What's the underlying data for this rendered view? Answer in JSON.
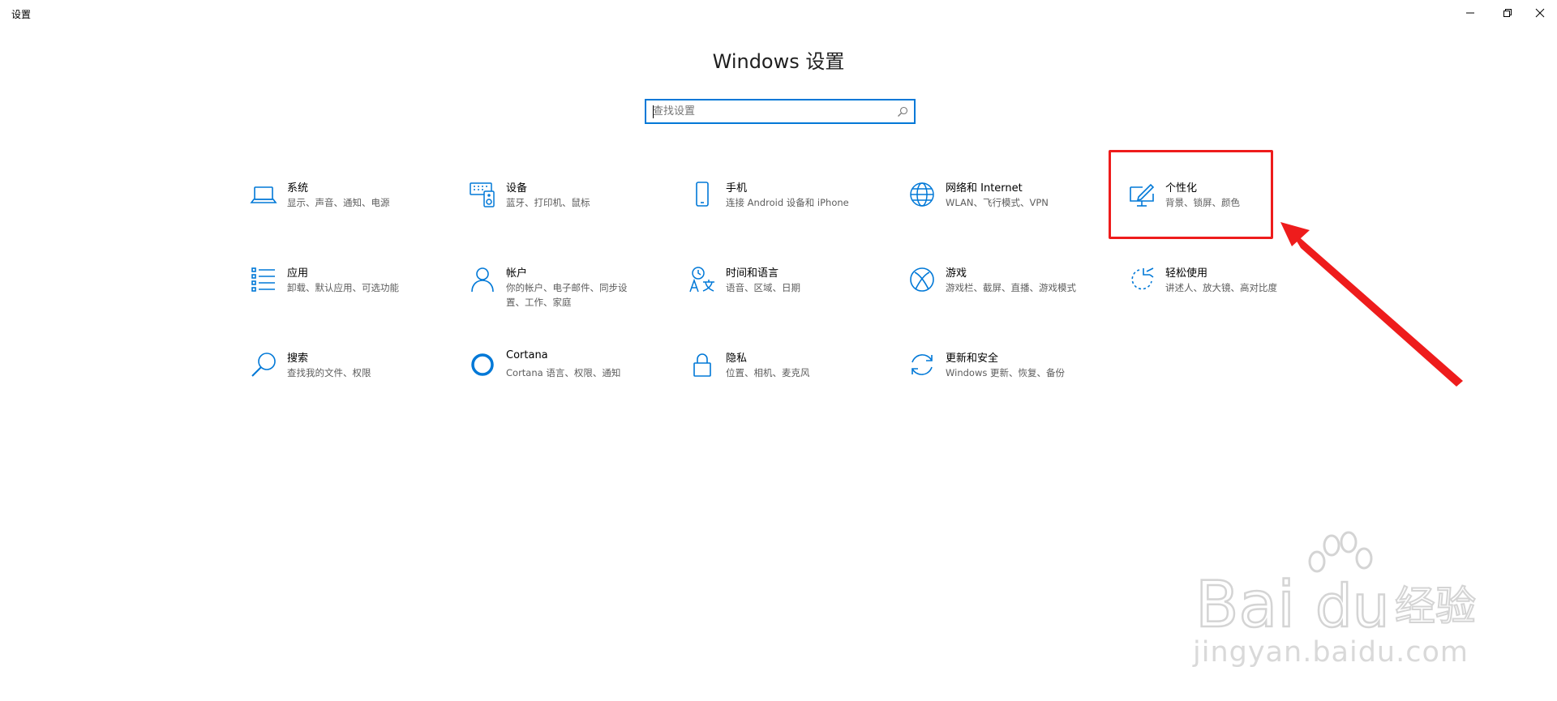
{
  "window": {
    "title": "设置",
    "controls": {
      "minimize": "minimize-icon",
      "restore": "restore-icon",
      "close": "close-icon"
    }
  },
  "page": {
    "title": "Windows 设置"
  },
  "search": {
    "placeholder": "查找设置",
    "icon": "search-icon"
  },
  "accent_color": "#0078d7",
  "tiles": [
    {
      "name": "系统",
      "desc": "显示、声音、通知、电源",
      "icon": "laptop-icon"
    },
    {
      "name": "设备",
      "desc": "蓝牙、打印机、鼠标",
      "icon": "devices-icon"
    },
    {
      "name": "手机",
      "desc": "连接 Android 设备和 iPhone",
      "icon": "phone-icon"
    },
    {
      "name": "网络和 Internet",
      "desc": "WLAN、飞行模式、VPN",
      "icon": "globe-icon"
    },
    {
      "name": "个性化",
      "desc": "背景、锁屏、颜色",
      "icon": "personalization-icon"
    },
    {
      "name": "应用",
      "desc": "卸载、默认应用、可选功能",
      "icon": "apps-list-icon"
    },
    {
      "name": "帐户",
      "desc": "你的帐户、电子邮件、同步设置、工作、家庭",
      "icon": "person-icon"
    },
    {
      "name": "时间和语言",
      "desc": "语音、区域、日期",
      "icon": "time-language-icon"
    },
    {
      "name": "游戏",
      "desc": "游戏栏、截屏、直播、游戏模式",
      "icon": "xbox-icon"
    },
    {
      "name": "轻松使用",
      "desc": "讲述人、放大镜、高对比度",
      "icon": "ease-of-access-icon"
    },
    {
      "name": "搜索",
      "desc": "查找我的文件、权限",
      "icon": "magnifier-icon"
    },
    {
      "name": "Cortana",
      "desc": "Cortana 语言、权限、通知",
      "icon": "cortana-icon"
    },
    {
      "name": "隐私",
      "desc": "位置、相机、麦克风",
      "icon": "lock-icon"
    },
    {
      "name": "更新和安全",
      "desc": "Windows 更新、恢复、备份",
      "icon": "sync-icon"
    }
  ],
  "annotation": {
    "color": "#ee1c1c",
    "highlighted_tile": "个性化"
  },
  "watermark": {
    "brand": "Bai du 经验",
    "url": "jingyan.baidu.com"
  }
}
